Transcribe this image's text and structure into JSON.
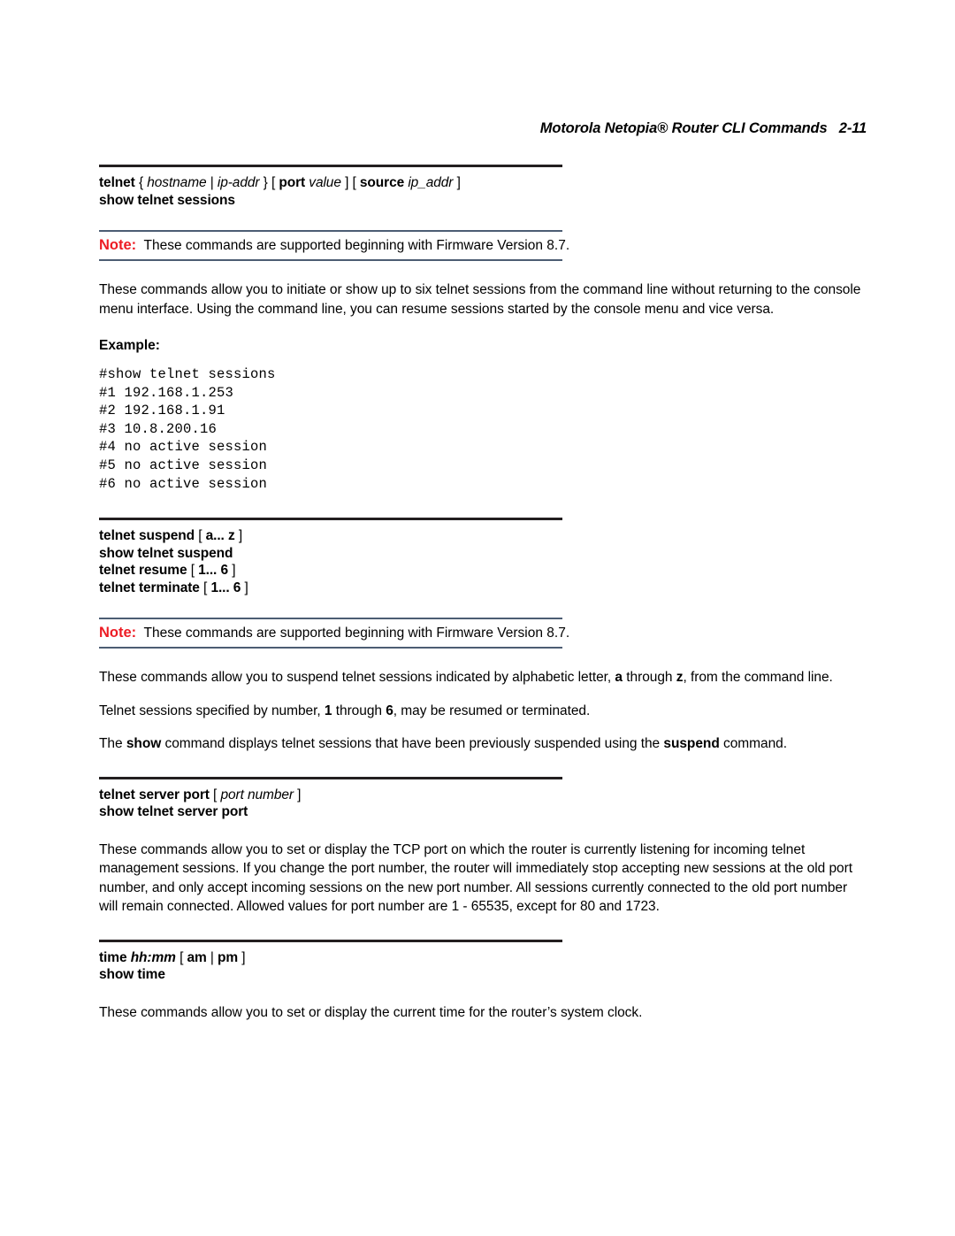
{
  "header": {
    "text": "Motorola Netopia® Router CLI Commands   2-11"
  },
  "colors": {
    "note_label": "#ed1c24",
    "note_rule": "#4c5d73",
    "command_rule": "#231f20",
    "text": "#000000",
    "background": "#ffffff"
  },
  "sections": {
    "telnet_sessions": {
      "commands": [
        {
          "segments": [
            {
              "text": "telnet ",
              "style": "lit"
            },
            {
              "text": "{ ",
              "style": "punct"
            },
            {
              "text": "hostname",
              "style": "var"
            },
            {
              "text": " | ",
              "style": "punct"
            },
            {
              "text": "ip-addr",
              "style": "var"
            },
            {
              "text": " } ",
              "style": "punct"
            },
            {
              "text": "[ ",
              "style": "punct"
            },
            {
              "text": "port ",
              "style": "lit"
            },
            {
              "text": "value",
              "style": "var"
            },
            {
              "text": " ] ",
              "style": "punct"
            },
            {
              "text": "[ ",
              "style": "punct"
            },
            {
              "text": "source ",
              "style": "lit"
            },
            {
              "text": "ip_addr",
              "style": "var"
            },
            {
              "text": " ]",
              "style": "punct"
            }
          ]
        },
        {
          "segments": [
            {
              "text": "show telnet sessions",
              "style": "lit"
            }
          ]
        }
      ],
      "note": {
        "label": "Note:",
        "text": "These commands are supported beginning with Firmware Version 8.7."
      },
      "paragraph": "These commands allow you to initiate or show up to six telnet sessions from the command line without returning to the console menu interface. Using the command line, you can resume sessions started by the console menu and vice versa.",
      "example_heading": "Example:",
      "example_code": "#show telnet sessions\n#1 192.168.1.253\n#2 192.168.1.91\n#3 10.8.200.16\n#4 no active session\n#5 no active session\n#6 no active session"
    },
    "telnet_suspend": {
      "commands": [
        {
          "segments": [
            {
              "text": "telnet suspend ",
              "style": "lit"
            },
            {
              "text": "[ ",
              "style": "punct"
            },
            {
              "text": "a... z",
              "style": "lit"
            },
            {
              "text": " ]",
              "style": "punct"
            }
          ]
        },
        {
          "segments": [
            {
              "text": "show telnet suspend",
              "style": "lit"
            }
          ]
        },
        {
          "segments": [
            {
              "text": "telnet resume ",
              "style": "lit"
            },
            {
              "text": "[ ",
              "style": "punct"
            },
            {
              "text": "1... 6",
              "style": "lit"
            },
            {
              "text": " ]",
              "style": "punct"
            }
          ]
        },
        {
          "segments": [
            {
              "text": "telnet terminate ",
              "style": "lit"
            },
            {
              "text": "[ ",
              "style": "punct"
            },
            {
              "text": "1... 6",
              "style": "lit"
            },
            {
              "text": " ]",
              "style": "punct"
            }
          ]
        }
      ],
      "note": {
        "label": "Note:",
        "text": "These commands are supported beginning with Firmware Version 8.7."
      },
      "paragraph_1": {
        "parts": [
          {
            "text": "These commands allow you to suspend telnet sessions indicated by alphabetic letter, ",
            "bold": false
          },
          {
            "text": "a",
            "bold": true
          },
          {
            "text": " through ",
            "bold": false
          },
          {
            "text": "z",
            "bold": true
          },
          {
            "text": ", from the command line.",
            "bold": false
          }
        ]
      },
      "paragraph_2": {
        "parts": [
          {
            "text": "Telnet sessions specified by number, ",
            "bold": false
          },
          {
            "text": "1",
            "bold": true
          },
          {
            "text": " through ",
            "bold": false
          },
          {
            "text": "6",
            "bold": true
          },
          {
            "text": ", may be resumed or terminated.",
            "bold": false
          }
        ]
      },
      "paragraph_3": {
        "parts": [
          {
            "text": "The ",
            "bold": false
          },
          {
            "text": "show",
            "bold": true
          },
          {
            "text": " command displays telnet sessions that have been previously suspended using the ",
            "bold": false
          },
          {
            "text": "suspend",
            "bold": true
          },
          {
            "text": " command.",
            "bold": false
          }
        ]
      }
    },
    "telnet_server_port": {
      "commands": [
        {
          "segments": [
            {
              "text": "telnet server port ",
              "style": "lit"
            },
            {
              "text": "[ ",
              "style": "punct"
            },
            {
              "text": "port number",
              "style": "var"
            },
            {
              "text": " ]",
              "style": "punct"
            }
          ]
        },
        {
          "segments": [
            {
              "text": "show telnet server port",
              "style": "lit"
            }
          ]
        }
      ],
      "paragraph": "These commands allow you to set or display the TCP port on which the router is currently listening for incoming telnet management sessions. If you change the port number, the router will immediately stop accepting new sessions at the old port number, and only accept incoming sessions on the new port number.  All sessions currently connected to the old port number will remain connected.  Allowed values for port number are 1 - 65535, except for 80 and 1723."
    },
    "time": {
      "commands": [
        {
          "segments": [
            {
              "text": "time ",
              "style": "lit"
            },
            {
              "text": "hh:mm",
              "style": "varb"
            },
            {
              "text": " [ ",
              "style": "punct"
            },
            {
              "text": "am",
              "style": "lit"
            },
            {
              "text": " | ",
              "style": "punct"
            },
            {
              "text": "pm",
              "style": "lit"
            },
            {
              "text": " ]",
              "style": "punct"
            }
          ]
        },
        {
          "segments": [
            {
              "text": "show time",
              "style": "lit"
            }
          ]
        }
      ],
      "paragraph": "These commands allow you to set or display the current time for the router’s system clock."
    }
  }
}
